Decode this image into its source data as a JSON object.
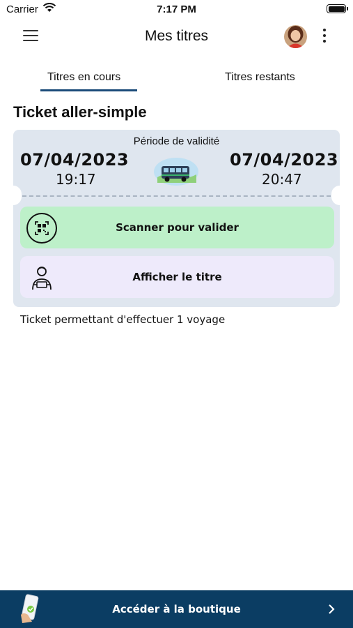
{
  "status_bar": {
    "carrier": "Carrier",
    "time": "7:17 PM"
  },
  "header": {
    "title": "Mes titres"
  },
  "tabs": [
    {
      "label": "Titres en cours",
      "active": true
    },
    {
      "label": "Titres restants",
      "active": false
    }
  ],
  "ticket": {
    "title": "Ticket aller-simple",
    "validity_label": "Période de validité",
    "start_date": "07/04/2023",
    "start_time": "19:17",
    "end_date": "07/04/2023",
    "end_time": "20:47",
    "scan_label": "Scanner pour valider",
    "show_label": "Afficher le titre",
    "description": "Ticket permettant d'effectuer 1 voyage"
  },
  "shop": {
    "label": "Accéder à la boutique"
  },
  "colors": {
    "accent": "#1b4b79",
    "card_bg": "#dfe6ef",
    "scan_bg": "#bdf0c9",
    "show_bg": "#eeeafb",
    "shop_bar": "#0b3d63"
  },
  "icons": {
    "menu": "hamburger-icon",
    "more": "more-vertical-icon",
    "scan": "qr-scan-icon",
    "show": "person-ticket-icon",
    "bus": "bus-icon",
    "shop": "phone-shop-icon",
    "chevron": "chevron-right-icon"
  }
}
